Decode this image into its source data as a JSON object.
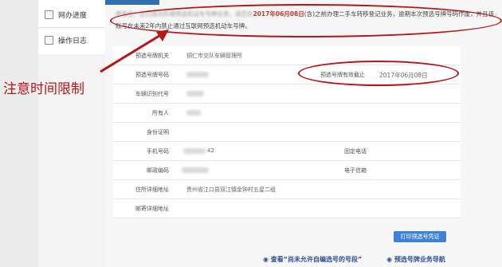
{
  "sidebar": {
    "items": [
      {
        "label": "网办进度",
        "icon": "document-icon"
      },
      {
        "label": "操作日志",
        "icon": "log-icon"
      }
    ]
  },
  "notice": {
    "part1": "恭喜您！您已成功办理预选机动车号牌业务，请您在",
    "date": "2017年06月08日",
    "part2": "(含)之前办理二手车转移登记业务，逾期本次预选号牌号码作废，并且该账号在未来2年内禁止通过互联网预选机动车号牌。"
  },
  "form": {
    "agency_label": "预选号牌机关",
    "agency_value": "铜仁市交队车辆管理所",
    "plate_label": "预选号牌号码",
    "expiry_label": "预选号牌有效截止",
    "expiry_value": "2017年06月08日",
    "vin_label": "车辆识别代号",
    "owner_label": "所有人",
    "id_label": "身份证明",
    "phone_label": "手机号码",
    "phone_partial": "42",
    "landline_label": "固定电话",
    "postcode_label": "邮政编码",
    "email_label": "电子信箱",
    "address_label": "住所详细地址",
    "address_value": "贵州省江口县双江镇金钟村五星二组",
    "mail_address_label": "邮寄详细地址"
  },
  "buttons": {
    "print": "打印预选号凭证"
  },
  "links": {
    "view_restricted": "查看“尚未允许自编选号的号段”",
    "plate_nav": "预选号牌业务导航"
  },
  "annotation": {
    "text": "注意时间限制",
    "color": "#b8141a"
  },
  "colors": {
    "accent_blue": "#3d82d3",
    "highlight_red": "#c0392b"
  }
}
